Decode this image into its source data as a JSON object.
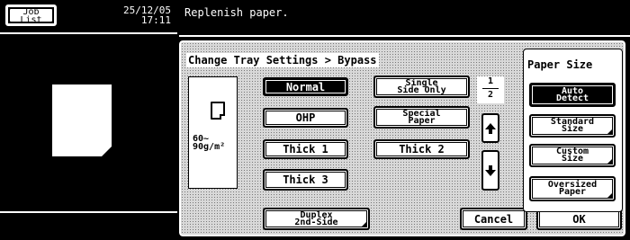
{
  "left_panel": {
    "job_list_label_line1": "Job",
    "job_list_label_line2": "List",
    "date": "25/12/05",
    "time": "17:11"
  },
  "message": "Replenish paper.",
  "main": {
    "breadcrumb": "Change Tray Settings > Bypass",
    "paper_weight_line1": "60~",
    "paper_weight_line2": "90g/m²",
    "paper_types": {
      "normal": "Normal",
      "single_side_line1": "Single",
      "single_side_line2": "Side Only",
      "ohp": "OHP",
      "special_line1": "Special",
      "special_line2": "Paper",
      "thick1": "Thick 1",
      "thick2": "Thick 2",
      "thick3": "Thick 3"
    },
    "page_current": "1",
    "page_total": "2",
    "duplex_line1": "Duplex",
    "duplex_line2": "2nd-Side",
    "cancel": "Cancel",
    "ok": "OK"
  },
  "paper_size": {
    "title": "Paper Size",
    "auto_line1": "Auto",
    "auto_line2": "Detect",
    "standard_line1": "Standard",
    "standard_line2": "Size",
    "custom_line1": "Custom",
    "custom_line2": "Size",
    "oversized_line1": "Oversized",
    "oversized_line2": "Paper"
  },
  "icons": {
    "up": "up-arrow-icon",
    "down": "down-arrow-icon",
    "paper": "paper-icon",
    "doc": "document-icon"
  },
  "colors": {
    "background": "#000000",
    "panel": "#d8d8d8",
    "button": "#ffffff",
    "selected": "#000000"
  }
}
